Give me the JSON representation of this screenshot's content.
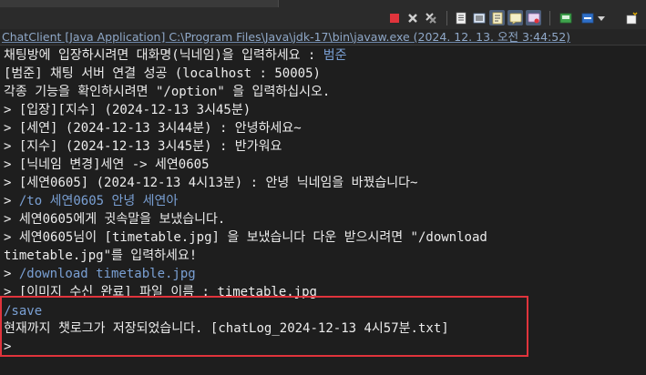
{
  "window": {
    "title": "ChatClient [Java Application] C:\\Program Files\\Java\\jdk-17\\bin\\javaw.exe  (2024. 12. 13. 오전 3:44:52)"
  },
  "toolbar": {
    "icons": [
      "terminate-icon",
      "remove-launch-icon",
      "remove-all-icon",
      "console-view-icon",
      "scroll-lock-icon",
      "word-wrap-icon",
      "show-on-output-icon",
      "pin-console-icon",
      "display-console-icon",
      "open-console-icon",
      "dropdown-icon",
      "new-console-icon"
    ]
  },
  "console": {
    "lines": [
      {
        "text": "채팅방에 입장하시려면 대화명(닉네임)을 입력하세요 : ",
        "input": "범준"
      },
      {
        "text": "[범준] 채팅 서버 연결 성공 (localhost : 50005)"
      },
      {
        "text": "각종 기능을 확인하시려면 \"/option\" 을 입력하십시오."
      },
      {
        "text": "> [입장][지수] (2024-12-13 3시45분)"
      },
      {
        "text": "> [세연] (2024-12-13 3시44분) : 안녕하세요~"
      },
      {
        "text": "> [지수] (2024-12-13 3시45분) : 반가워요"
      },
      {
        "text": "> [닉네임 변경]세연 -> 세연0605"
      },
      {
        "text": "> [세연0605] (2024-12-13 4시13분) : 안녕 닉네임을 바꿨습니다~"
      },
      {
        "text": "> ",
        "input": "/to 세연0605 안녕 세연아"
      },
      {
        "text": "> 세연0605에게 귓속말을 보냈습니다."
      },
      {
        "text": "> 세연0605님이 [timetable.jpg] 을 보냈습니다 다운 받으시려면 \"/download"
      },
      {
        "text": "timetable.jpg\"를 입력하세요!"
      },
      {
        "text": "> ",
        "input": "/download timetable.jpg"
      },
      {
        "text": "> [이미지 수신 완료] 파일 이름 : timetable.jpg"
      },
      {
        "text": "",
        "input": "/save"
      },
      {
        "text": "현재까지 챗로그가 저장되었습니다. [chatLog_2024-12-13 4시57분.txt]"
      },
      {
        "text": "> "
      }
    ]
  },
  "colors": {
    "background": "#1e1e1e",
    "text": "#ececec",
    "user_input": "#7aa0d4",
    "highlight_box": "#e0343c"
  }
}
